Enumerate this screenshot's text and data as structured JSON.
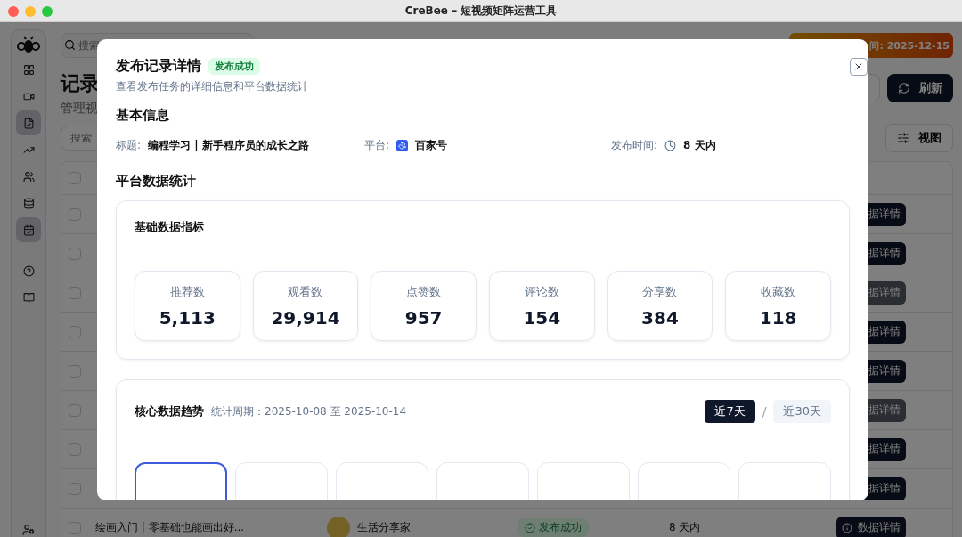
{
  "window": {
    "title": "CreBee – 短视频矩阵运营工具"
  },
  "sidebar": {
    "items": [
      {
        "selected": false
      },
      {
        "selected": false
      },
      {
        "selected": true
      },
      {
        "selected": false
      },
      {
        "selected": false
      },
      {
        "selected": false
      },
      {
        "selected": true
      },
      {
        "selected": false
      },
      {
        "selected": false
      }
    ]
  },
  "background": {
    "search": {
      "placeholder": "搜索"
    },
    "banner": "间: 2025-12-15",
    "page_title": "记录",
    "page_subtitle": "管理视",
    "refresh_button": "刷新",
    "filter": {
      "placeholder": "搜索"
    },
    "view_button": "视图",
    "select_all": {
      "checked": false
    },
    "rows": [
      {
        "checked": false,
        "action": "据详情",
        "disabled": false
      },
      {
        "checked": false,
        "action": "据详情",
        "disabled": false
      },
      {
        "checked": false,
        "action": "据详情",
        "disabled": true
      },
      {
        "checked": false,
        "action": "据详情",
        "disabled": false
      },
      {
        "checked": false,
        "action": "据详情",
        "disabled": false
      },
      {
        "checked": false,
        "action": "据详情",
        "disabled": true
      },
      {
        "checked": false,
        "action": "据详情",
        "disabled": false
      },
      {
        "checked": false,
        "action": "据详情",
        "disabled": false
      },
      {
        "checked": false,
        "title": "绘画入门 | 零基础也能画出好...",
        "account": "生活分享家",
        "status": "发布成功",
        "time": "8 天内",
        "action": "数据详情",
        "disabled": false
      }
    ]
  },
  "dialog": {
    "title": "发布记录详情",
    "badge": "发布成功",
    "description": "查看发布任务的详细信息和平台数据统计",
    "basic_info": {
      "heading": "基本信息",
      "fields": [
        {
          "kind": "text",
          "label": "标题:",
          "value": "编程学习 | 新手程序员的成长之路"
        },
        {
          "kind": "platform",
          "label": "平台:",
          "value": "百家号"
        },
        {
          "kind": "time",
          "label": "发布时间:",
          "value": "8 天内"
        }
      ]
    },
    "stats": {
      "heading": "平台数据统计",
      "basic_card": {
        "title": "基础数据指标",
        "metrics": [
          {
            "label": "推荐数",
            "value": "5,113"
          },
          {
            "label": "观看数",
            "value": "29,914"
          },
          {
            "label": "点赞数",
            "value": "957"
          },
          {
            "label": "评论数",
            "value": "154"
          },
          {
            "label": "分享数",
            "value": "384"
          },
          {
            "label": "收藏数",
            "value": "118"
          }
        ]
      },
      "trend_card": {
        "title": "核心数据趋势",
        "period": "统计周期：2025-10-08 至 2025-10-14",
        "ranges": [
          {
            "label": "近7天",
            "selected": true
          },
          {
            "label": "近30天",
            "selected": false
          }
        ],
        "separator": "/",
        "tabs": [
          {
            "selected": true
          },
          {
            "selected": false
          },
          {
            "selected": false
          },
          {
            "selected": false
          },
          {
            "selected": false
          },
          {
            "selected": false
          },
          {
            "selected": false
          }
        ]
      }
    }
  }
}
